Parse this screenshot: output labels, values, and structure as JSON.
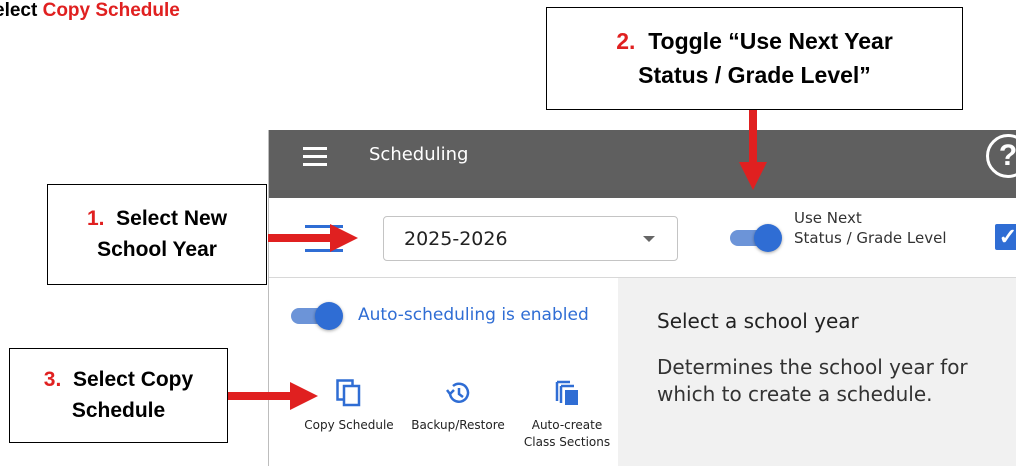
{
  "heading": {
    "prefix": "elect ",
    "highlight": "Copy Schedule"
  },
  "callouts": [
    {
      "num": "1.",
      "line1": "Select New",
      "line2": "School Year"
    },
    {
      "num": "2.",
      "line1": "Toggle “Use Next Year",
      "line2": "Status / Grade Level”"
    },
    {
      "num": "3.",
      "line1": "Select Copy",
      "line2": "Schedule"
    }
  ],
  "app": {
    "title": "Scheduling",
    "help_icon": "help-icon",
    "year_select": {
      "value": "2025-2026"
    },
    "next_year_toggle": {
      "on": true,
      "label_line1": "Use Next",
      "label_line2": "Status / Grade Level"
    },
    "checkbox_checked": true,
    "auto_scheduling": {
      "on": true,
      "label": "Auto-scheduling is enabled"
    },
    "tools": [
      {
        "icon": "copy-icon",
        "label": "Copy Schedule"
      },
      {
        "icon": "history-icon",
        "label": "Backup/Restore"
      },
      {
        "icon": "layers-icon",
        "label_line1": "Auto-create",
        "label_line2": "Class Sections"
      }
    ],
    "info": {
      "title": "Select a school year",
      "description": "Determines the school year for which to create a schedule."
    }
  },
  "colors": {
    "annotation_red": "#e02020",
    "accent_blue": "#2f6dd4",
    "topbar": "#5f5f5f"
  }
}
